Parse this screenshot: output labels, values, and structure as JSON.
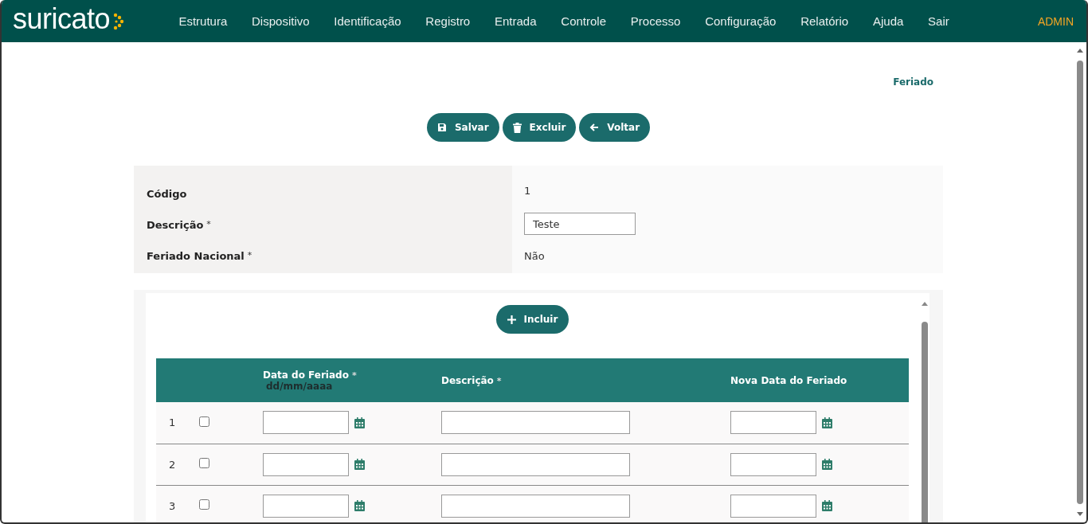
{
  "logo": {
    "text": "suricato"
  },
  "nav": [
    {
      "label": "Estrutura"
    },
    {
      "label": "Dispositivo"
    },
    {
      "label": "Identificação"
    },
    {
      "label": "Registro"
    },
    {
      "label": "Entrada"
    },
    {
      "label": "Controle"
    },
    {
      "label": "Processo"
    },
    {
      "label": "Configuração"
    },
    {
      "label": "Relatório"
    },
    {
      "label": "Ajuda"
    },
    {
      "label": "Sair"
    }
  ],
  "user": "ADMIN",
  "page_title": "Feriado",
  "actions": [
    {
      "label": "Salvar",
      "kind": "save"
    },
    {
      "label": "Excluir",
      "kind": "delete"
    },
    {
      "label": "Voltar",
      "kind": "back"
    }
  ],
  "required_mark": "*",
  "form": {
    "fields": [
      {
        "label": "Código",
        "required": false,
        "kind": "text",
        "value": "1"
      },
      {
        "label": "Descrição",
        "required": true,
        "kind": "input",
        "value": "Teste"
      },
      {
        "label": "Feriado Nacional",
        "required": true,
        "kind": "text",
        "value": "Não"
      }
    ]
  },
  "grid": {
    "add_button": "Incluir",
    "columns": [
      {
        "label": "Data do Feriado",
        "required": true,
        "hint": "dd/mm/aaaa",
        "kind": "date"
      },
      {
        "label": "Descrição",
        "required": true,
        "kind": "text"
      },
      {
        "label": "Nova Data do Feriado",
        "required": false,
        "kind": "date"
      }
    ],
    "rows": [
      {
        "number": "1",
        "checked": false
      },
      {
        "number": "2",
        "checked": false
      },
      {
        "number": "3",
        "checked": false
      }
    ]
  }
}
